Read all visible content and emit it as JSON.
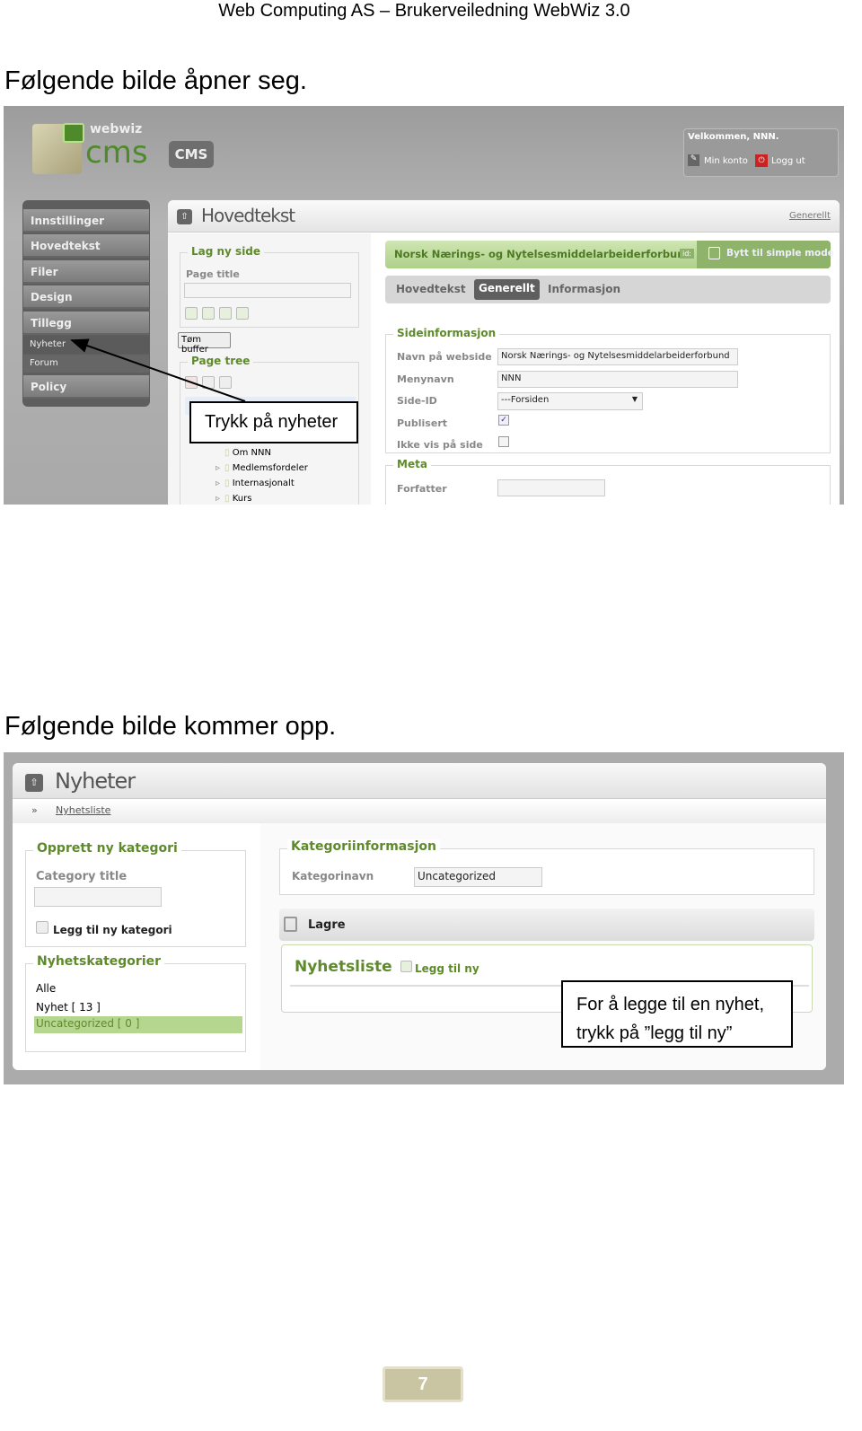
{
  "header": {
    "title": "Web Computing AS – Brukerveiledning WebWiz 3.0"
  },
  "section1": {
    "text": "Følgende bilde åpner seg."
  },
  "section2": {
    "text": "Følgende bilde kommer opp."
  },
  "screenshot1": {
    "logo": {
      "top": "webwiz",
      "bottom": "cms"
    },
    "cms_button": "CMS",
    "welcome": {
      "text": "Velkommen, NNN.",
      "account": "Min konto",
      "logout": "Logg ut"
    },
    "sidebar": {
      "items": [
        "Innstillinger",
        "Hovedtekst",
        "Filer",
        "Design",
        "Tillegg"
      ],
      "subitems": [
        "Nyheter",
        "Forum"
      ],
      "last": "Policy"
    },
    "panel": {
      "title": "Hovedtekst",
      "link": "Generellt"
    },
    "new_page": {
      "legend": "Lag ny side",
      "label": "Page title",
      "value": ""
    },
    "clear_buffer": "Tøm buffer",
    "page_tree": {
      "legend": "Page tree",
      "items": [
        "Om NNN",
        "Medlemsfordeler",
        "Internasjonalt",
        "Kurs"
      ]
    },
    "site_bar": {
      "name": "Norsk Nærings- og Nytelsesmiddelarbeiderforbund",
      "id_badge": "id:",
      "simple_mode": "Bytt til simple mode"
    },
    "tabs": [
      {
        "label": "Hovedtekst",
        "active": false
      },
      {
        "label": "Generellt",
        "active": true
      },
      {
        "label": "Informasjon",
        "active": false
      }
    ],
    "site_info": {
      "legend": "Sideinformasjon",
      "website_name_label": "Navn på webside",
      "website_name": "Norsk Nærings- og Nytelsesmiddelarbeiderforbund",
      "menu_name_label": "Menynavn",
      "menu_name": "NNN",
      "page_id_label": "Side-ID",
      "page_id": "---Forsiden",
      "published_label": "Publisert",
      "published": true,
      "hide_label": "Ikke vis på side",
      "hide": false
    },
    "meta": {
      "legend": "Meta",
      "author_label": "Forfatter",
      "author": ""
    },
    "callout": "Trykk på nyheter"
  },
  "screenshot2": {
    "title": "Nyheter",
    "breadcrumb_sep": "»",
    "breadcrumb": "Nyhetsliste",
    "create_category": {
      "legend": "Opprett ny kategori",
      "label": "Category title",
      "value": "",
      "button": "Legg til ny kategori"
    },
    "categories": {
      "legend": "Nyhetskategorier",
      "items": [
        {
          "label": "Alle",
          "selected": false
        },
        {
          "label": "Nyhet [ 13 ]",
          "selected": false
        },
        {
          "label": "Uncategorized [ 0 ]",
          "selected": true
        }
      ]
    },
    "category_info": {
      "legend": "Kategoriinformasjon",
      "label": "Kategorinavn",
      "value": "Uncategorized"
    },
    "save": "Lagre",
    "news_list": {
      "title": "Nyhetsliste",
      "add": "Legg til ny"
    },
    "callout_line1": "For å legge til en nyhet,",
    "callout_line2": "trykk på ”legg til ny”"
  },
  "footer": {
    "page_number": "7"
  },
  "colors": {
    "accent_green": "#5e8a2c",
    "highlight": "#b5d68f",
    "screen_bg": "#a8a8a8"
  }
}
